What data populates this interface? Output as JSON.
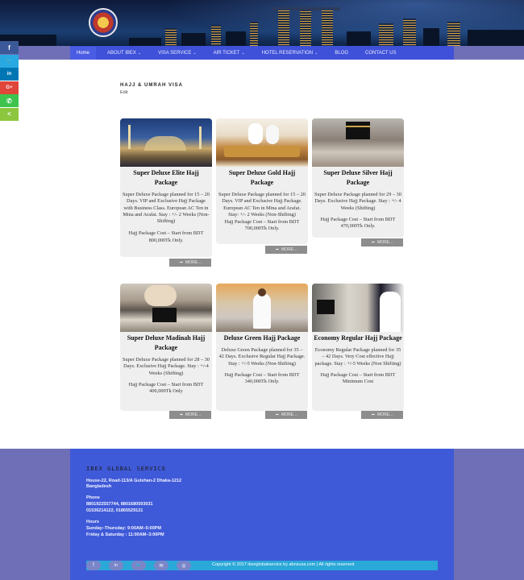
{
  "nav": {
    "items": [
      {
        "label": "Home",
        "caret": ""
      },
      {
        "label": "ABOUT IBEX",
        "caret": "⌄"
      },
      {
        "label": "VISA SERVICE",
        "caret": "⌄"
      },
      {
        "label": "AIR TICKET",
        "caret": "⌄"
      },
      {
        "label": "HOTEL RESERVATION",
        "caret": "⌄"
      },
      {
        "label": "BLOG",
        "caret": ""
      },
      {
        "label": "CONTACT US",
        "caret": ""
      }
    ]
  },
  "social": [
    {
      "icon": "facebook-icon",
      "glyph": "f",
      "color": "#3b5998"
    },
    {
      "icon": "twitter-icon",
      "glyph": "🐦",
      "color": "#29a9e1"
    },
    {
      "icon": "linkedin-icon",
      "glyph": "in",
      "color": "#0077b5"
    },
    {
      "icon": "googleplus-icon",
      "glyph": "G+",
      "color": "#e0463a"
    },
    {
      "icon": "whatsapp-icon",
      "glyph": "✆",
      "color": "#3ec44e"
    },
    {
      "icon": "share-icon",
      "glyph": "<",
      "color": "#8cc63f"
    }
  ],
  "page": {
    "title": "HAJJ & UMRAH VISA",
    "edit": "Edit"
  },
  "cards": [
    {
      "title": "Super Deluxe Elite Hajj Package",
      "desc": "Super Deluxe Package planned for 15 – 20 Days. VIP and Exclusive Hajj Package with Business Class. European AC Ten in Mina and Arafat. Stay : +/- 2 Weeks (Non-Shifting)",
      "cost": "Hajj Package Cost – Start from BDT 800,000Tk Only.",
      "more": "MORE..."
    },
    {
      "title": "Super Deluxe Gold Hajj Package",
      "desc": "Super Deluxe Package planned for 15 – 20 Days. VIP and Exclusive Hajj Package. European AC Ten in Mina and Arafat. Stay: +/- 2 Weeks (Non-Shifting)",
      "cost": "Hajj Package Cost – Start from BDT 700,000Tk Only.",
      "more": "MORE..."
    },
    {
      "title": "Super Deluxe Silver Hajj Package",
      "desc": "Super Deluxe Package planned for 29 – 30 Days. Exclusive Hajj Package. Stay : +/- 4 Weeks (Shifting)",
      "cost": "Hajj Package Cost – Start from BDT 470,000Tk Only.",
      "more": "MORE..."
    },
    {
      "title": "Super Deluxe Madinah Hajj Package",
      "desc": "Super Deluxe Package planned for 28 – 30 Days. Exclusive Hajj Package. Stay : +/-4 Weeks (Shifting)",
      "cost": "Hajj Package Cost – Start from BDT 400,000Tk Only",
      "more": "MORE..."
    },
    {
      "title": "Deluxe Green Hajj Package",
      "desc": "Deluxe Green Package planned for 35 – 42 Days. Exclusive Regular Hajj Package. Stay : +/-5 Weeks (Non-Shifting)",
      "cost": "Hajj Package Cost – Start from BDT 340,000Tk Only.",
      "more": "MORE..."
    },
    {
      "title": "Economy Regular Hajj Package",
      "desc": "Economy Regular Package planned for 35 – 42 Days. Very Cost effective Hajj package. Stay : +/-5 Weeks (Non Shifting)",
      "cost": "Hajj Package Cost – Start from BDT Minimum Cost",
      "more": "MORE..."
    }
  ],
  "footer": {
    "title": "IBEX GLOBAL SERVICE",
    "address1": "House-22, Road-113/A Gulshan-2 Dhaka-1212",
    "address2": "Bangladesh",
    "phone_label": "Phone",
    "phone1": "8801922557744, 8801680593031",
    "phone2": "01536214122, 01865529121",
    "hours_label": "Hours",
    "hours1": "Sunday–Thursday: 9:00AM–5:00PM",
    "hours2": "Friday & Saturday : 11:00AM–3:00PM",
    "copyright": "Copyright © 2017 ibexglobalservice by abnzusa.com | All rights reserved",
    "icons": [
      {
        "name": "facebook-icon",
        "glyph": "f"
      },
      {
        "name": "linkedin-icon",
        "glyph": "in"
      },
      {
        "name": "twitter-icon",
        "glyph": "🐦"
      },
      {
        "name": "email-icon",
        "glyph": "✉"
      },
      {
        "name": "instagram-icon",
        "glyph": "◎"
      }
    ]
  }
}
